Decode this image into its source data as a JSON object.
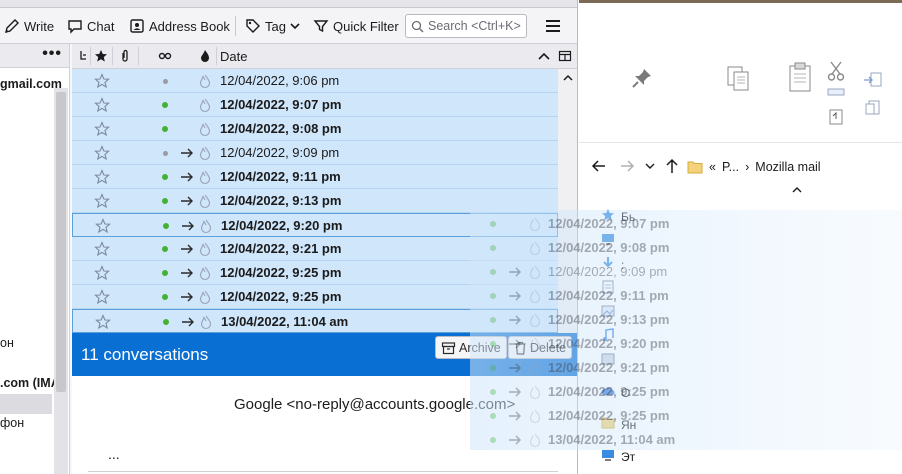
{
  "toolbar": {
    "write_label": "Write",
    "chat_label": "Chat",
    "address_book_label": "Address Book",
    "tag_label": "Tag",
    "quick_filter_label": "Quick Filter",
    "search_placeholder": "Search <Ctrl+K>"
  },
  "folders": {
    "items": [
      {
        "text": "gmail.com"
      },
      {
        "text": "он"
      },
      {
        "text": ".com (IMA"
      },
      {
        "text": "фон"
      }
    ]
  },
  "thread": {
    "date_header": "Date",
    "rows": [
      {
        "date": "12/04/2022, 9:06 pm",
        "unread": false,
        "forwarded": false
      },
      {
        "date": "12/04/2022, 9:07 pm",
        "unread": true,
        "forwarded": false
      },
      {
        "date": "12/04/2022, 9:08 pm",
        "unread": true,
        "forwarded": false
      },
      {
        "date": "12/04/2022, 9:09 pm",
        "unread": false,
        "forwarded": true
      },
      {
        "date": "12/04/2022, 9:11 pm",
        "unread": true,
        "forwarded": true
      },
      {
        "date": "12/04/2022, 9:13 pm",
        "unread": true,
        "forwarded": true
      },
      {
        "date": "12/04/2022, 9:20 pm",
        "unread": true,
        "forwarded": true
      },
      {
        "date": "12/04/2022, 9:21 pm",
        "unread": true,
        "forwarded": true
      },
      {
        "date": "12/04/2022, 9:25 pm",
        "unread": true,
        "forwarded": true
      },
      {
        "date": "12/04/2022, 9:25 pm",
        "unread": true,
        "forwarded": true
      },
      {
        "date": "13/04/2022, 11:04 am",
        "unread": true,
        "forwarded": true
      }
    ]
  },
  "message": {
    "conversations_label": "11 conversations",
    "archive_label": "Archive",
    "delete_label": "Delete",
    "from": "Google <no-reply@accounts.google.com>",
    "ellipsis": "..."
  },
  "explorer": {
    "breadcrumb_prefix": "«",
    "breadcrumb_parent": "P...",
    "breadcrumb_current": "Mozilla mail",
    "items": [
      {
        "text": "Бь",
        "icon": "star-icon"
      },
      {
        "text": "",
        "icon": "monitor-icon"
      },
      {
        "text": ":",
        "icon": "download-icon"
      },
      {
        "text": "",
        "icon": "document-icon"
      },
      {
        "text": "",
        "icon": "image-icon"
      },
      {
        "text": "",
        "icon": "music-icon"
      },
      {
        "text": "",
        "icon": "video-icon"
      },
      {
        "text": "O",
        "icon": "cloud-icon"
      },
      {
        "text": "Ян",
        "icon": "folder-icon"
      },
      {
        "text": "Эт",
        "icon": "computer-icon"
      }
    ]
  },
  "colors": {
    "accent": "#0a6fd2",
    "selected_row": "#cfe6fb",
    "unread_dot": "#43b134"
  }
}
